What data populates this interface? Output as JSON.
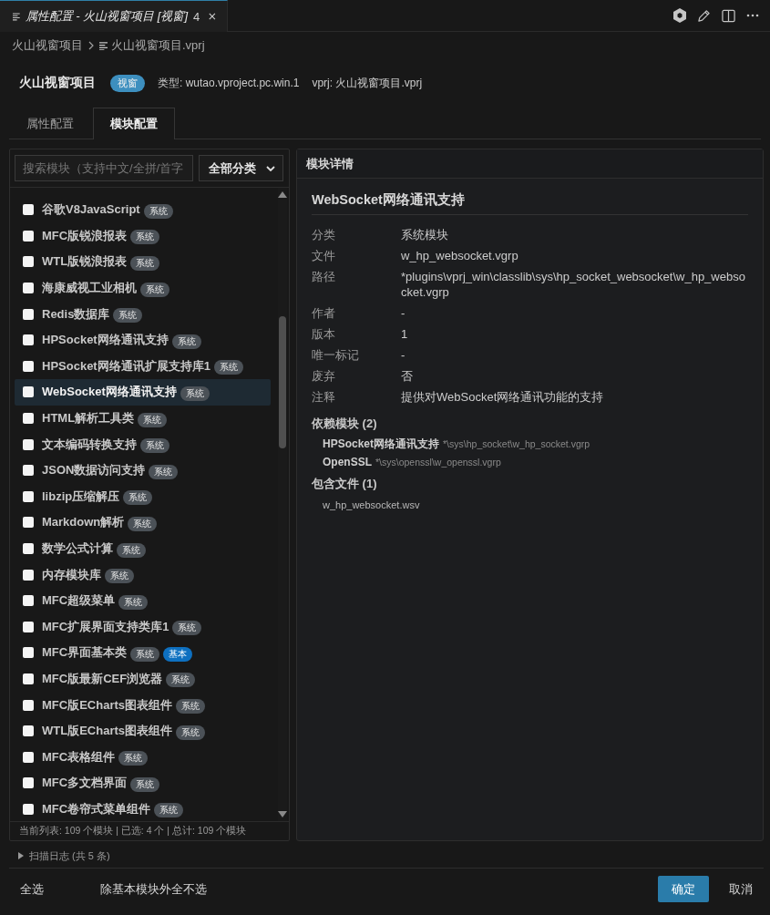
{
  "editor_tab": {
    "title": "属性配置 - 火山视窗项目 [视窗]",
    "count": "4",
    "preview": true
  },
  "breadcrumb": [
    {
      "label": "火山视窗项目",
      "kind": "folder"
    },
    {
      "label": "火山视窗项目.vprj",
      "kind": "file"
    }
  ],
  "project": {
    "name": "火山视窗项目",
    "badge": "视窗",
    "type": "类型: wutao.vproject.pc.win.1",
    "vprj": "vprj: 火山视窗项目.vprj"
  },
  "tabs": [
    {
      "label": "属性配置",
      "selected": false
    },
    {
      "label": "模块配置",
      "selected": true
    }
  ],
  "module_list": {
    "search": {
      "placeholder": "搜索模块（支持中文/全拼/首字"
    },
    "category_select": {
      "value": "全部分类"
    },
    "items": [
      {
        "name": "谷歌V8JavaScript",
        "checked": false,
        "selected": false,
        "tags": [
          {
            "label": "系统",
            "kind": "system"
          }
        ]
      },
      {
        "name": "MFC版锐浪报表",
        "checked": false,
        "selected": false,
        "tags": [
          {
            "label": "系统",
            "kind": "system"
          }
        ]
      },
      {
        "name": "WTL版锐浪报表",
        "checked": false,
        "selected": false,
        "tags": [
          {
            "label": "系统",
            "kind": "system"
          }
        ]
      },
      {
        "name": "海康威视工业相机",
        "checked": false,
        "selected": false,
        "tags": [
          {
            "label": "系统",
            "kind": "system"
          }
        ]
      },
      {
        "name": "Redis数据库",
        "checked": false,
        "selected": false,
        "tags": [
          {
            "label": "系统",
            "kind": "system"
          }
        ]
      },
      {
        "name": "HPSocket网络通讯支持",
        "checked": false,
        "selected": false,
        "tags": [
          {
            "label": "系统",
            "kind": "system"
          }
        ]
      },
      {
        "name": "HPSocket网络通讯扩展支持库1",
        "checked": false,
        "selected": false,
        "tags": [
          {
            "label": "系统",
            "kind": "system"
          }
        ]
      },
      {
        "name": "WebSocket网络通讯支持",
        "checked": false,
        "selected": true,
        "tags": [
          {
            "label": "系统",
            "kind": "system"
          }
        ]
      },
      {
        "name": "HTML解析工具类",
        "checked": false,
        "selected": false,
        "tags": [
          {
            "label": "系统",
            "kind": "system"
          }
        ]
      },
      {
        "name": "文本编码转换支持",
        "checked": false,
        "selected": false,
        "tags": [
          {
            "label": "系统",
            "kind": "system"
          }
        ]
      },
      {
        "name": "JSON数据访问支持",
        "checked": false,
        "selected": false,
        "tags": [
          {
            "label": "系统",
            "kind": "system"
          }
        ]
      },
      {
        "name": "libzip压缩解压",
        "checked": false,
        "selected": false,
        "tags": [
          {
            "label": "系统",
            "kind": "system"
          }
        ]
      },
      {
        "name": "Markdown解析",
        "checked": false,
        "selected": false,
        "tags": [
          {
            "label": "系统",
            "kind": "system"
          }
        ]
      },
      {
        "name": "数学公式计算",
        "checked": false,
        "selected": false,
        "tags": [
          {
            "label": "系统",
            "kind": "system"
          }
        ]
      },
      {
        "name": "内存模块库",
        "checked": false,
        "selected": false,
        "tags": [
          {
            "label": "系统",
            "kind": "system"
          }
        ]
      },
      {
        "name": "MFC超级菜单",
        "checked": false,
        "selected": false,
        "tags": [
          {
            "label": "系统",
            "kind": "system"
          }
        ]
      },
      {
        "name": "MFC扩展界面支持类库1",
        "checked": false,
        "selected": false,
        "tags": [
          {
            "label": "系统",
            "kind": "system"
          }
        ]
      },
      {
        "name": "MFC界面基本类",
        "checked": false,
        "selected": false,
        "tags": [
          {
            "label": "系统",
            "kind": "system"
          },
          {
            "label": "基本",
            "kind": "basic"
          }
        ]
      },
      {
        "name": "MFC版最新CEF浏览器",
        "checked": false,
        "selected": false,
        "tags": [
          {
            "label": "系统",
            "kind": "system"
          }
        ]
      },
      {
        "name": "MFC版ECharts图表组件",
        "checked": false,
        "selected": false,
        "tags": [
          {
            "label": "系统",
            "kind": "system"
          }
        ]
      },
      {
        "name": "WTL版ECharts图表组件",
        "checked": false,
        "selected": false,
        "tags": [
          {
            "label": "系统",
            "kind": "system"
          }
        ]
      },
      {
        "name": "MFC表格组件",
        "checked": false,
        "selected": false,
        "tags": [
          {
            "label": "系统",
            "kind": "system"
          }
        ]
      },
      {
        "name": "MFC多文档界面",
        "checked": false,
        "selected": false,
        "tags": [
          {
            "label": "系统",
            "kind": "system"
          }
        ]
      },
      {
        "name": "MFC卷帘式菜单组件",
        "checked": false,
        "selected": false,
        "tags": [
          {
            "label": "系统",
            "kind": "system"
          }
        ]
      }
    ],
    "status": "当前列表: 109 个模块 | 已选: 4 个 | 总计: 109 个模块"
  },
  "detail": {
    "header": "模块详情",
    "title": "WebSocket网络通讯支持",
    "fields": [
      {
        "label": "分类",
        "value": "系统模块"
      },
      {
        "label": "文件",
        "value": "w_hp_websocket.vgrp"
      },
      {
        "label": "路径",
        "value": "*plugins\\vprj_win\\classlib\\sys\\hp_socket_websocket\\w_hp_websocket.vgrp"
      },
      {
        "label": "作者",
        "value": "-"
      },
      {
        "label": "版本",
        "value": "1"
      },
      {
        "label": "唯一标记",
        "value": "-"
      },
      {
        "label": "废弃",
        "value": "否"
      },
      {
        "label": "注释",
        "value": "提供对WebSocket网络通讯功能的支持"
      }
    ],
    "dependencies": {
      "heading": "依赖模块 (2)",
      "items": [
        {
          "name": "HPSocket网络通讯支持",
          "path": "*\\sys\\hp_socket\\w_hp_socket.vgrp"
        },
        {
          "name": "OpenSSL",
          "path": "*\\sys\\openssl\\w_openssl.vgrp"
        }
      ]
    },
    "files": {
      "heading": "包含文件 (1)",
      "items": [
        "w_hp_websocket.wsv"
      ]
    }
  },
  "scan_log": {
    "label": "扫描日志 (共 5 条)",
    "expanded": false
  },
  "footer": {
    "left_buttons": [
      {
        "label": "全选",
        "kind": "text"
      },
      {
        "label": "除基本模块外全不选",
        "kind": "text"
      }
    ],
    "right_buttons": [
      {
        "label": "确定",
        "kind": "primary"
      },
      {
        "label": "取消",
        "kind": "text"
      }
    ]
  }
}
